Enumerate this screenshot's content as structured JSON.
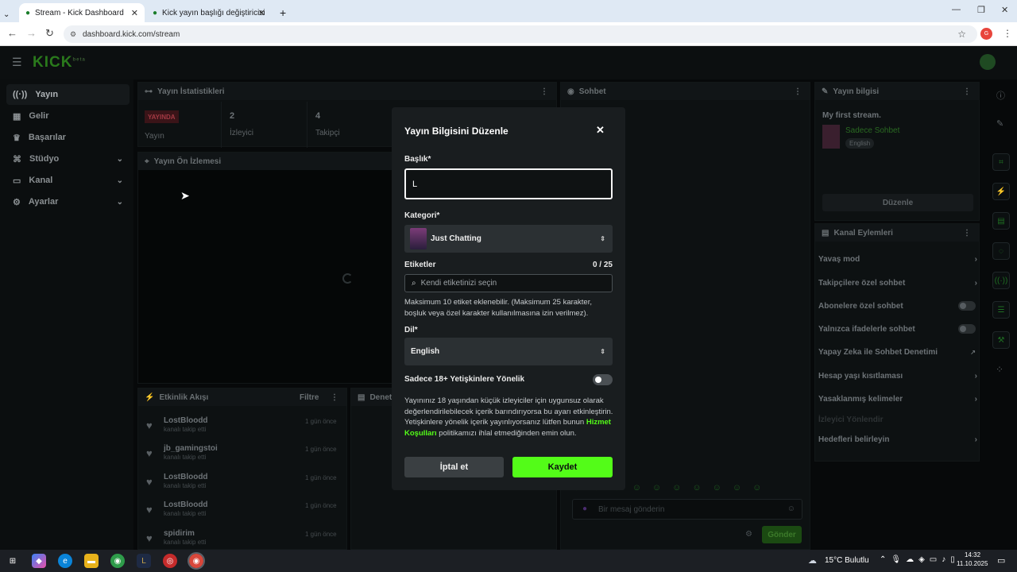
{
  "browser": {
    "tabs": [
      {
        "title": "Stream - Kick Dashboard",
        "active": true
      },
      {
        "title": "Kick yayın başlığı değiştiricisi",
        "active": false
      }
    ],
    "url": "dashboard.kick.com/stream",
    "new_tab": "+"
  },
  "app": {
    "logo": "KICK",
    "logo_sup": "beta"
  },
  "sidebar": {
    "items": [
      {
        "label": "Yayın",
        "icon": "broadcast-icon",
        "selected": true
      },
      {
        "label": "Gelir",
        "icon": "revenue-icon"
      },
      {
        "label": "Başarılar",
        "icon": "trophy-icon"
      },
      {
        "label": "Stüdyo",
        "icon": "studio-icon",
        "expandable": true
      },
      {
        "label": "Kanal",
        "icon": "channel-icon",
        "expandable": true
      },
      {
        "label": "Ayarlar",
        "icon": "settings-icon",
        "expandable": true
      }
    ]
  },
  "stats": {
    "title": "Yayın İstatistikleri",
    "live_badge": "YAYINDA",
    "live_label": "Yayın",
    "viewers_value": "2",
    "viewers_label": "İzleyici",
    "followers_value": "4",
    "followers_label": "Takipçi"
  },
  "preview": {
    "title": "Yayın Ön İzlemesi"
  },
  "activity": {
    "title": "Etkinlik Akışı",
    "filter": "Filtre",
    "mod_title": "Denetim",
    "items": [
      {
        "name": "LostBloodd",
        "sub": "kanalı takip etti",
        "time": "1 gün önce"
      },
      {
        "name": "jb_gamingstoi",
        "sub": "kanalı takip etti",
        "time": "1 gün önce"
      },
      {
        "name": "LostBloodd",
        "sub": "kanalı takip etti",
        "time": "1 gün önce"
      },
      {
        "name": "LostBloodd",
        "sub": "kanalı takip etti",
        "time": "1 gün önce"
      },
      {
        "name": "spidirim",
        "sub": "kanalı takip etti",
        "time": "1 gün önce"
      }
    ]
  },
  "chat": {
    "title": "Sohbet",
    "placeholder": "Bir mesaj gönderin",
    "send": "Gönder"
  },
  "stream_info": {
    "title": "Yayın bilgisi",
    "stream_title": "My first stream.",
    "category": "Sadece Sohbet",
    "language": "English",
    "edit": "Düzenle"
  },
  "channel_actions": {
    "title": "Kanal Eylemleri",
    "items": [
      {
        "label": "Yavaş mod",
        "control": "chevron"
      },
      {
        "label": "Takipçilere özel sohbet",
        "control": "chevron"
      },
      {
        "label": "Abonelere özel sohbet",
        "control": "toggle"
      },
      {
        "label": "Yalnızca ifadelerle sohbet",
        "control": "toggle"
      },
      {
        "label": "Yapay Zeka ile Sohbet Denetimi",
        "control": "external"
      },
      {
        "label": "Hesap yaşı kısıtlaması",
        "control": "chevron"
      },
      {
        "label": "Yasaklanmış kelimeler",
        "control": "chevron"
      },
      {
        "label": "İzleyici Yönlendir",
        "control": "none"
      },
      {
        "label": "Hedefleri belirleyin",
        "control": "chevron"
      }
    ]
  },
  "modal": {
    "title": "Yayın Bilgisini Düzenle",
    "title_label": "Başlık*",
    "title_value": "L",
    "category_label": "Kategori*",
    "category_value": "Just Chatting",
    "tags_label": "Etiketler",
    "tags_count": "0 / 25",
    "tags_placeholder": "Kendi etiketinizi seçin",
    "tags_help": "Maksimum 10 etiket eklenebilir. (Maksimum 25 karakter, boşluk veya özel karakter kullanılmasına izin verilmez).",
    "language_label": "Dil*",
    "language_value": "English",
    "mature_label": "Sadece 18+ Yetişkinlere Yönelik",
    "mature_on": false,
    "mature_help_1": "Yayınınız 18 yaşından küçük izleyiciler için uygunsuz olarak değerlendirilebilecek içerik barındırıyorsa bu ayarı etkinleştirin. Yetişkinlere yönelik içerik yayınlıyorsanız lütfen bunun ",
    "mature_help_link": "Hizmet Koşulları",
    "mature_help_2": " politikamızı ihlal etmediğinden emin olun.",
    "cancel": "İptal et",
    "save": "Kaydet",
    "accent": "#53fc18"
  },
  "taskbar": {
    "weather": "15°C Bulutlu",
    "time": "14:32",
    "date": "11.10.2025"
  }
}
